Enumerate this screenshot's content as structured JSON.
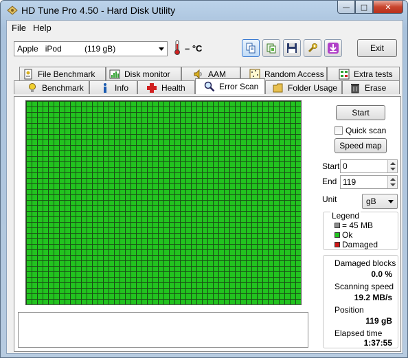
{
  "window": {
    "title": "HD Tune Pro 4.50 - Hard Disk Utility",
    "minimize_glyph": "—",
    "maximize_glyph": "□",
    "close_glyph": "✕"
  },
  "menu": {
    "file": "File",
    "help": "Help"
  },
  "toolbar": {
    "drive": "Apple   iPod          (119 gB)",
    "temperature": "– °C",
    "exit_label": "Exit"
  },
  "tabs_top": [
    {
      "label": "File Benchmark",
      "icon": "file-benchmark-icon"
    },
    {
      "label": "Disk monitor",
      "icon": "disk-monitor-icon"
    },
    {
      "label": "AAM",
      "icon": "speaker-icon"
    },
    {
      "label": "Random Access",
      "icon": "random-access-icon"
    },
    {
      "label": "Extra tests",
      "icon": "extra-tests-icon"
    }
  ],
  "tabs_bottom": [
    {
      "label": "Benchmark",
      "icon": "lightbulb-icon"
    },
    {
      "label": "Info",
      "icon": "info-icon"
    },
    {
      "label": "Health",
      "icon": "health-cross-icon"
    },
    {
      "label": "Error Scan",
      "icon": "magnifier-icon"
    },
    {
      "label": "Folder Usage",
      "icon": "folder-icon"
    },
    {
      "label": "Erase",
      "icon": "trash-icon"
    }
  ],
  "error_scan": {
    "start_button": "Start",
    "quick_scan_label": "Quick scan",
    "quick_scan_checked": false,
    "speed_map_button": "Speed map",
    "start_label": "Start",
    "start_value": "0",
    "end_label": "End",
    "end_value": "119",
    "unit_label": "Unit",
    "unit_value": "gB",
    "legend": {
      "title": "Legend",
      "block_size": "= 45 MB",
      "ok": "Ok",
      "damaged": "Damaged"
    },
    "stats": {
      "damaged_blocks_label": "Damaged blocks",
      "damaged_blocks_value": "0.0 %",
      "scanning_speed_label": "Scanning speed",
      "scanning_speed_value": "19.2 MB/s",
      "position_label": "Position",
      "position_value": "119 gB",
      "elapsed_label": "Elapsed time",
      "elapsed_value": "1:37:55"
    }
  },
  "colors": {
    "ok": "#22c31f",
    "damaged": "#d01818",
    "block": "#8c8c8c"
  }
}
